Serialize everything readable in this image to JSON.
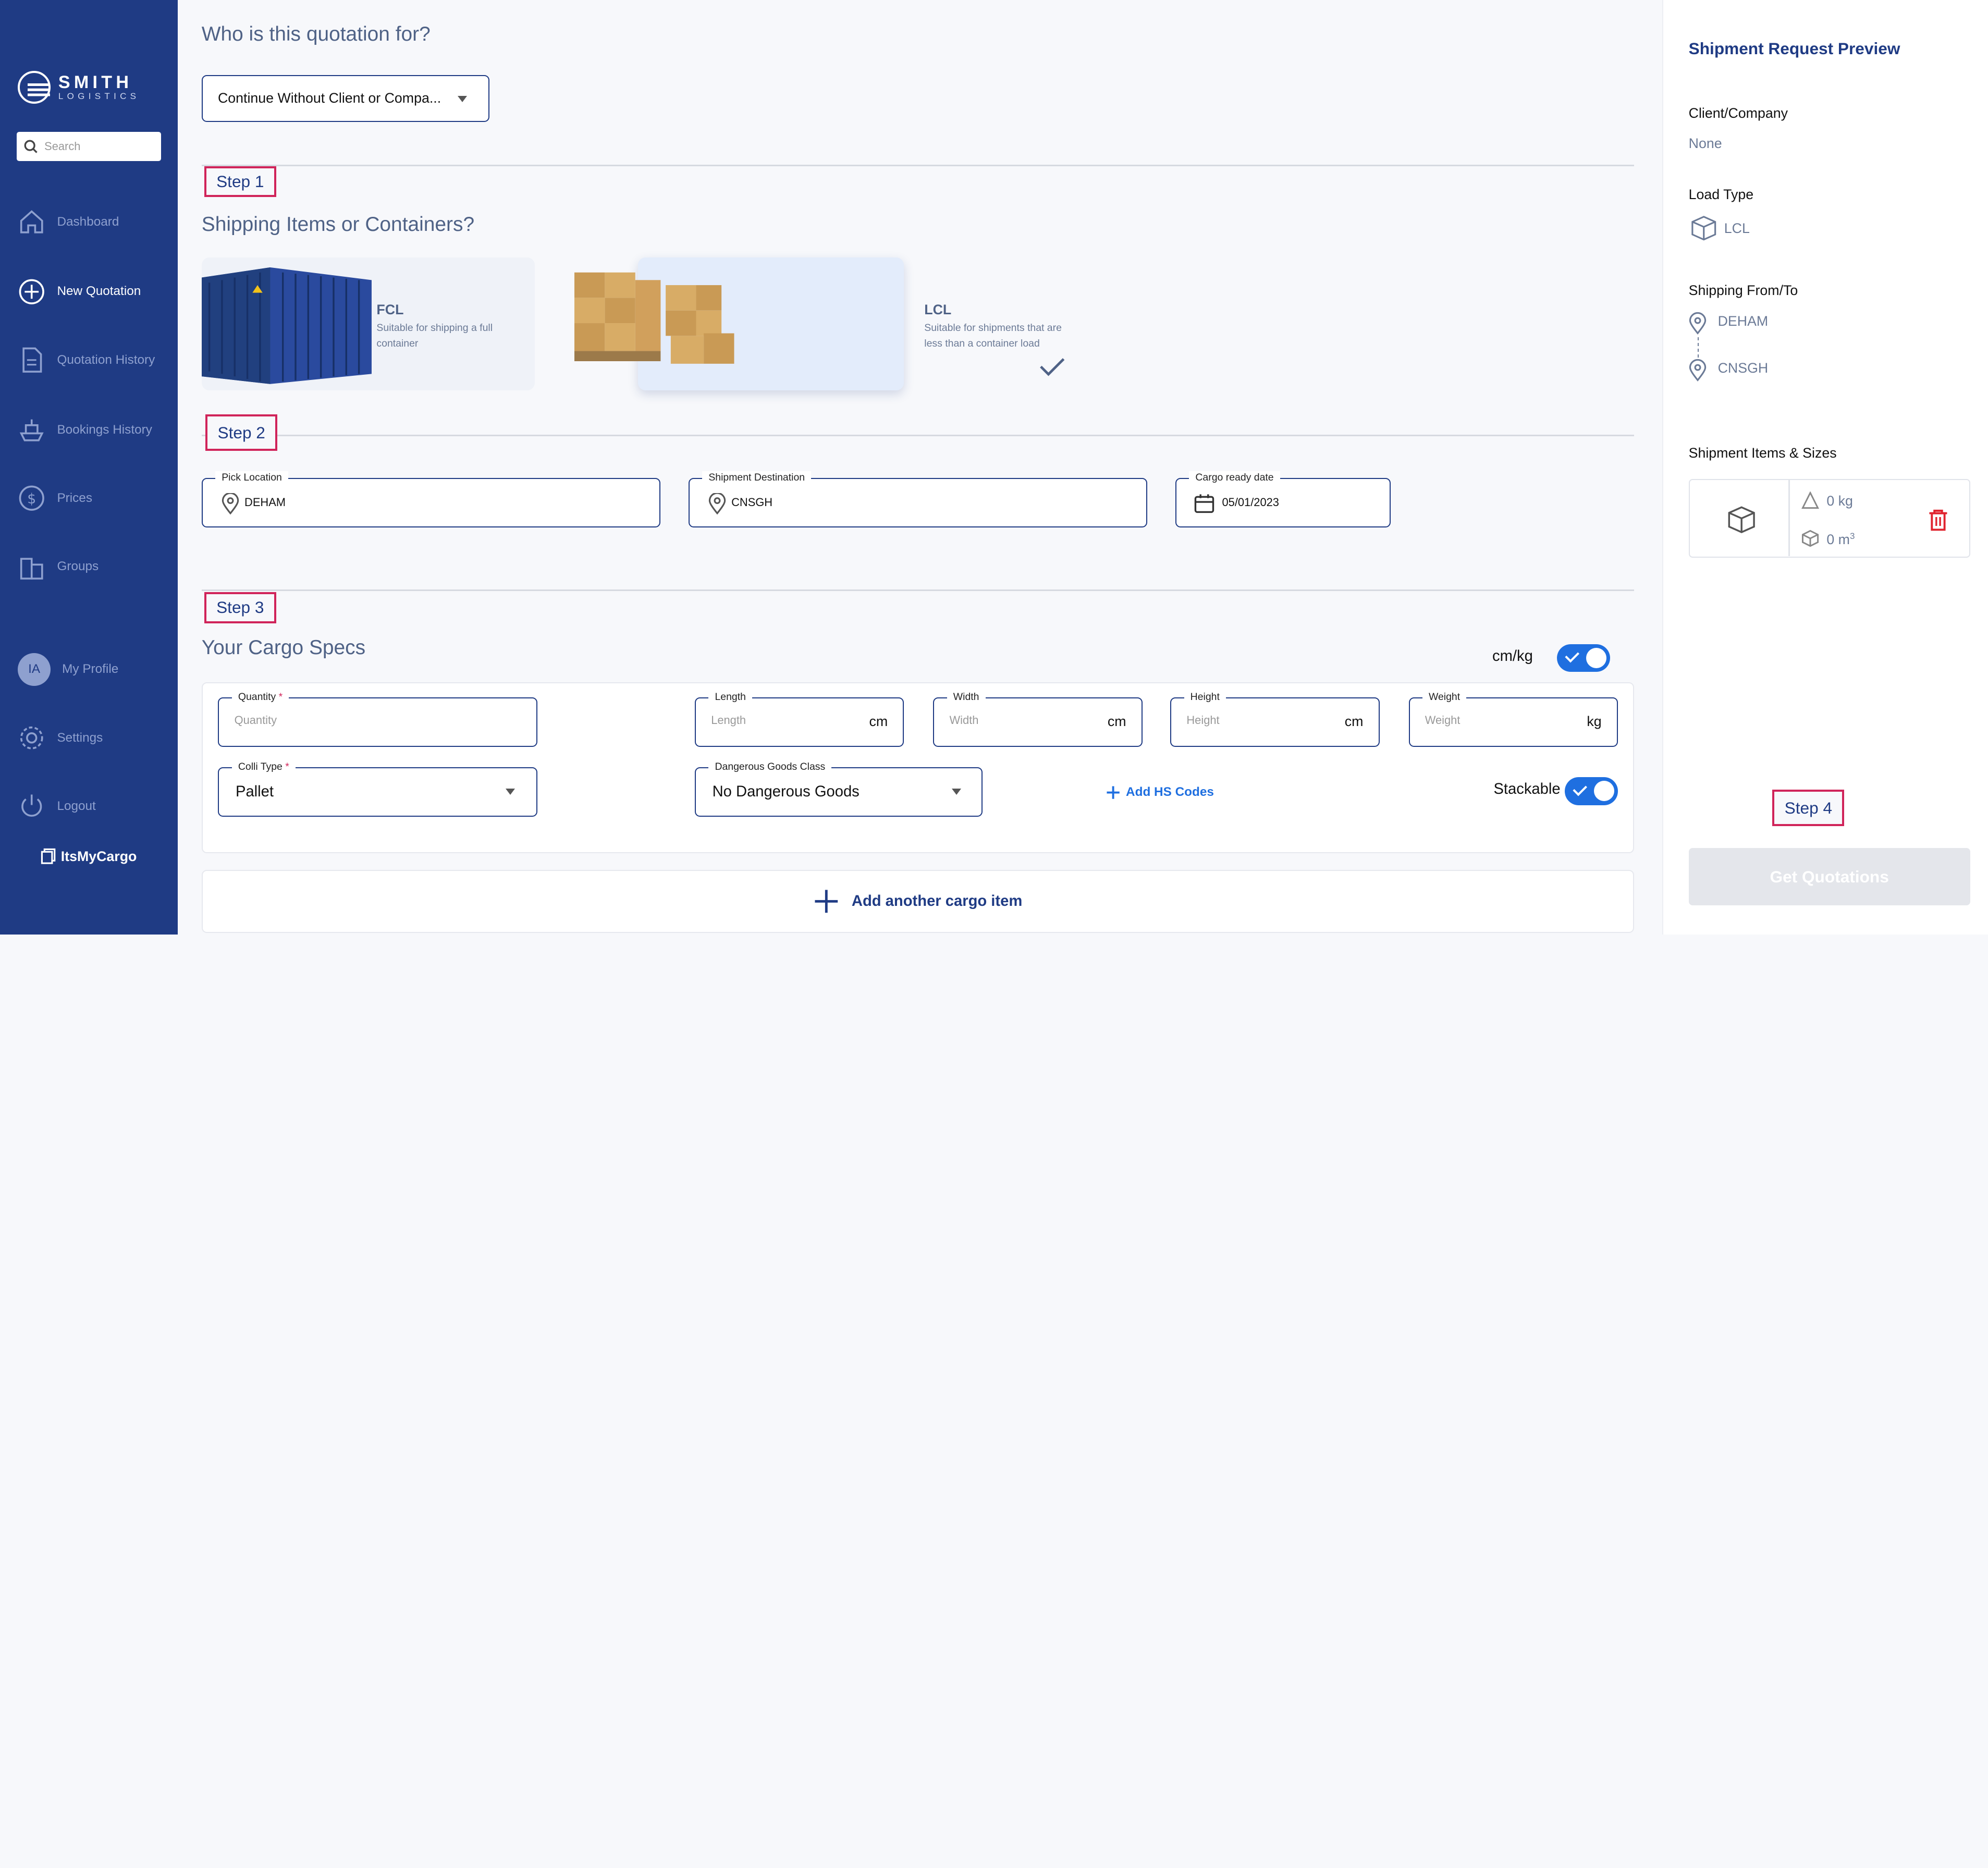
{
  "sidebar": {
    "logo_main": "SMITH",
    "logo_sub": "LOGISTICS",
    "search_placeholder": "Search",
    "nav": {
      "dashboard": "Dashboard",
      "new_quotation": "New Quotation",
      "quotation_history": "Quotation History",
      "bookings_history": "Bookings History",
      "prices": "Prices",
      "groups": "Groups",
      "my_profile": "My Profile",
      "settings": "Settings",
      "logout": "Logout"
    },
    "avatar_initials": "IA",
    "footer_brand": "ItsMyCargo"
  },
  "main": {
    "who_heading": "Who is this quotation for?",
    "client_select": "Continue Without Client or Compa...",
    "steps": {
      "s1": "Step 1",
      "s2": "Step 2",
      "s3": "Step 3",
      "s4": "Step 4"
    },
    "shipping_heading": "Shipping Items or Containers?",
    "fcl": {
      "title": "FCL",
      "desc": "Suitable for shipping a full container"
    },
    "lcl": {
      "title": "LCL",
      "desc": "Suitable for shipments that are less than a container load"
    },
    "pick_location": {
      "label": "Pick Location",
      "value": "DEHAM"
    },
    "destination": {
      "label": "Shipment Destination",
      "value": "CNSGH"
    },
    "ready_date": {
      "label": "Cargo ready date",
      "value": "05/01/2023"
    },
    "cargo_heading": "Your Cargo Specs",
    "unit_toggle_label": "cm/kg",
    "quantity": {
      "label": "Quantity",
      "placeholder": "Quantity",
      "required": "*"
    },
    "length": {
      "label": "Length",
      "placeholder": "Length",
      "unit": "cm"
    },
    "width": {
      "label": "Width",
      "placeholder": "Width",
      "unit": "cm"
    },
    "height": {
      "label": "Height",
      "placeholder": "Height",
      "unit": "cm"
    },
    "weight": {
      "label": "Weight",
      "placeholder": "Weight",
      "unit": "kg"
    },
    "colli": {
      "label": "Colli Type",
      "value": "Pallet",
      "required": "*"
    },
    "dangerous": {
      "label": "Dangerous Goods Class",
      "value": "No Dangerous Goods"
    },
    "add_hs": "Add HS Codes",
    "stackable_label": "Stackable",
    "add_cargo": "Add another cargo item"
  },
  "preview": {
    "title": "Shipment Request Preview",
    "client_label": "Client/Company",
    "client_value": "None",
    "load_label": "Load Type",
    "load_value": "LCL",
    "route_label": "Shipping From/To",
    "from": "DEHAM",
    "to": "CNSGH",
    "items_label": "Shipment Items & Sizes",
    "item_weight": "0 kg",
    "item_volume": "0 m",
    "item_volume_sup": "3",
    "get_button": "Get Quotations"
  },
  "colors": {
    "sidebar": "#1f3b84",
    "accent": "#1f6fe0",
    "step_border": "#d0245a",
    "delete": "#e0242f"
  }
}
